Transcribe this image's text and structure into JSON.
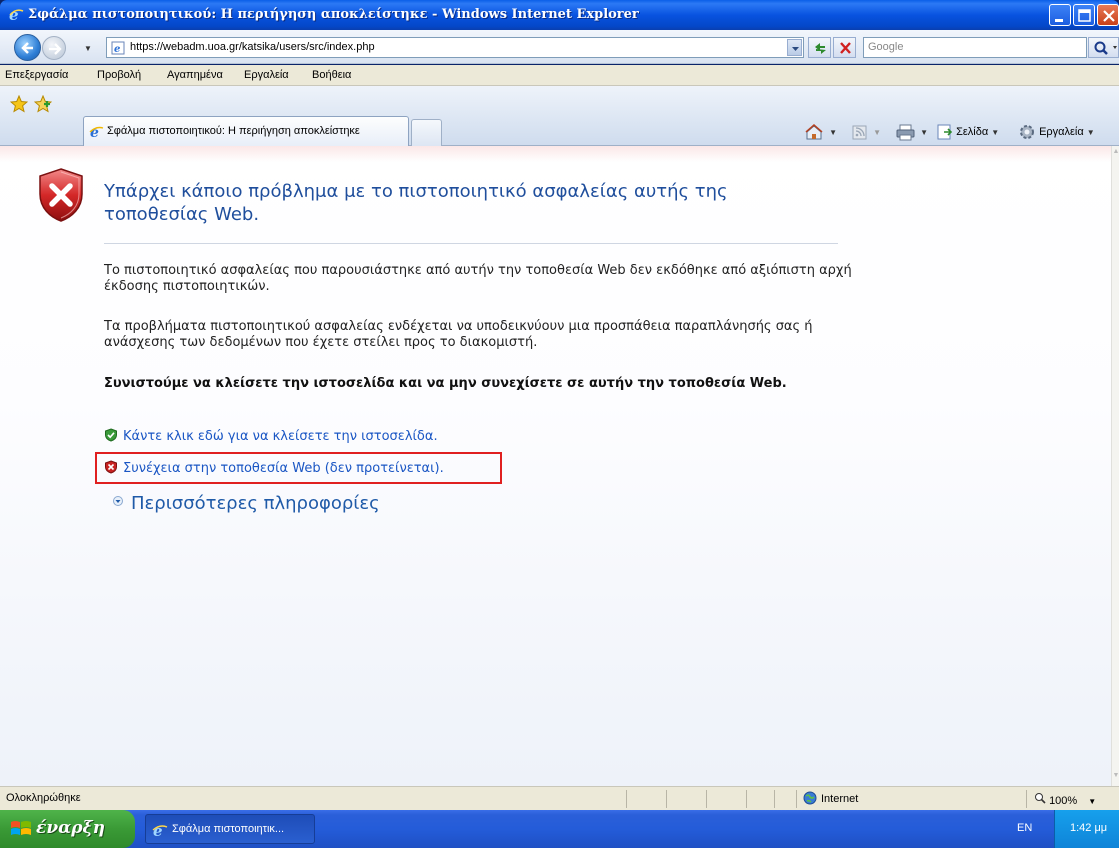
{
  "window": {
    "title": "Σφάλμα πιστοποιητικού: Η περιήγηση αποκλείστηκε - Windows Internet Explorer"
  },
  "address_bar": {
    "url": "https://webadm.uoa.gr/katsika/users/src/index.php",
    "search_placeholder": "Google"
  },
  "menu": {
    "items": [
      "Επεξεργασία",
      "Προβολή",
      "Αγαπημένα",
      "Εργαλεία",
      "Βοήθεια"
    ]
  },
  "tabs": {
    "active_label": "Σφάλμα πιστοποιητικού: Η περιήγηση αποκλείστηκε"
  },
  "command_bar": {
    "page_label": "Σελίδα",
    "tools_label": "Εργαλεία"
  },
  "content": {
    "title": "Υπάρχει κάποιο πρόβλημα με το πιστοποιητικό ασφαλείας αυτής της τοποθεσίας Web.",
    "paragraph1": "Το πιστοποιητικό ασφαλείας που παρουσιάστηκε από αυτήν την τοποθεσία Web δεν εκδόθηκε από αξιόπιστη αρχή έκδοσης πιστοποιητικών.",
    "paragraph2": "Τα προβλήματα πιστοποιητικού ασφαλείας ενδέχεται να υποδεικνύουν μια προσπάθεια παραπλάνησής σας ή ανάσχεσης των δεδομένων που έχετε στείλει προς το διακομιστή.",
    "recommendation": "Συνιστούμε να κλείσετε την ιστοσελίδα και να μην συνεχίσετε σε αυτήν την τοποθεσία Web.",
    "close_link": "Κάντε κλικ εδώ για να κλείσετε την ιστοσελίδα.",
    "continue_link": "Συνέχεια στην τοποθεσία Web (δεν προτείνεται).",
    "more_info": "Περισσότερες πληροφορίες"
  },
  "status_bar": {
    "status": "Ολοκληρώθηκε",
    "zone": "Internet",
    "zoom": "100%"
  },
  "taskbar": {
    "start_label": "έναρξη",
    "task_label": "Σφάλμα πιστοποιητικ...",
    "language": "EN",
    "clock": "1:42 μμ"
  },
  "colors": {
    "link": "#1a56c4",
    "title_text": "#1f4e9c",
    "highlight": "#e02020",
    "titlebar": "#0853e0"
  }
}
